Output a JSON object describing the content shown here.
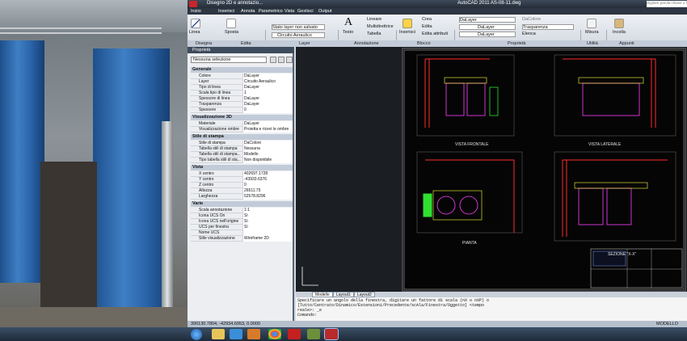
{
  "window": {
    "title": "Disegno 2D e annotazio...",
    "app_title": "AutoCAD 2011   AS-08-11.dwg",
    "search_placeholder": "Digitare parola chiave o frase"
  },
  "menu": [
    "Inizio",
    "Inserisci",
    "Annota",
    "Parametrico",
    "Vista",
    "Gestisci",
    "Output"
  ],
  "ribbon": {
    "disegna": {
      "label": "Disegna",
      "linea": "Linea"
    },
    "edita": {
      "label": "Edita",
      "sposta": "Sposta"
    },
    "layer": {
      "label": "Layer",
      "state": "Stato layer non salvato",
      "current": "Circuito Aeraulico"
    },
    "annotazione": {
      "label": "Annotazione",
      "testo": "Testo",
      "lineare": "Lineare",
      "multidirettrice": "Multidirettrice",
      "tabella": "Tabella"
    },
    "blocco": {
      "label": "Blocco",
      "inserisci": "Inserisci",
      "crea": "Crea",
      "edita": "Edita",
      "edita_attributi": "Edita attributi"
    },
    "proprieta": {
      "label": "Proprietà",
      "dalayer": "DaLayer",
      "dacolore": "DaColore",
      "trasparenza": "Trasparenza",
      "elenca": "Elenca"
    },
    "utilita": {
      "label": "Utilità",
      "misura": "Misura"
    },
    "appunti": {
      "label": "Appunti",
      "incolla": "Incolla"
    }
  },
  "props": {
    "title": "Proprietà",
    "selection": "Nessuna selezione",
    "generale": {
      "label": "Generale",
      "rows": [
        [
          "Colore",
          "DaLayer"
        ],
        [
          "Layer",
          "Circuito Aeraulico"
        ],
        [
          "Tipo di linea",
          "DaLayer"
        ],
        [
          "Scala tipo di linea",
          "1"
        ],
        [
          "Spessore di linea",
          "DaLayer"
        ],
        [
          "Trasparenza",
          "DaLayer"
        ],
        [
          "Spessore",
          "0"
        ]
      ]
    },
    "vis3d": {
      "label": "Visualizzazione 3D",
      "rows": [
        [
          "Materiale",
          "DaLayer"
        ],
        [
          "Visualizzazione ombre",
          "Proietta e ricevi le ombre"
        ]
      ]
    },
    "stampa": {
      "label": "Stile di stampa",
      "rows": [
        [
          "Stile di stampa",
          "DaColore"
        ],
        [
          "Tabella stili di stampa",
          "Nessuna"
        ],
        [
          "Tabella stili di stampa...",
          "Modello"
        ],
        [
          "Tipo tabella stili di sta...",
          "Non disponibile"
        ]
      ]
    },
    "vista": {
      "label": "Vista",
      "rows": [
        [
          "X centro",
          "402697.1728"
        ],
        [
          "Y centro",
          "-43933.6376"
        ],
        [
          "Z centro",
          "0"
        ],
        [
          "Altezza",
          "26511.75"
        ],
        [
          "Larghezza",
          "52578.8296"
        ]
      ]
    },
    "varie": {
      "label": "Varie",
      "rows": [
        [
          "Scala annotazione",
          "1:1"
        ],
        [
          "Icona UCS On",
          "Sì"
        ],
        [
          "Icona UCS nell'origine",
          "Sì"
        ],
        [
          "UCS per finestra",
          "Sì"
        ],
        [
          "Nome UCS",
          ""
        ],
        [
          "Stile visualizzazione",
          "Wireframe 2D"
        ]
      ]
    }
  },
  "drawing": {
    "labels": {
      "frontale": "VISTA FRONTALE",
      "laterale": "VISTA LATERALE",
      "pianta": "PIANTA",
      "sezione": "SEZIONE \"X-X\""
    }
  },
  "layout_tabs": [
    "Modello",
    "Layout1",
    "Layout2"
  ],
  "command": {
    "lines": [
      "Specificare un angolo della finestra, digitare un fattore di scala (nX o nXP) o",
      "[Tutto/Centrato/Dinamico/Estensioni/Precedente/scAla/Finestra/Oggetto] <tempo",
      "reale>: _e"
    ],
    "prompt": "Comando:"
  },
  "status": {
    "coords": "396130.7804, -42934.6953, 0.0000",
    "right": "MODELLO"
  }
}
